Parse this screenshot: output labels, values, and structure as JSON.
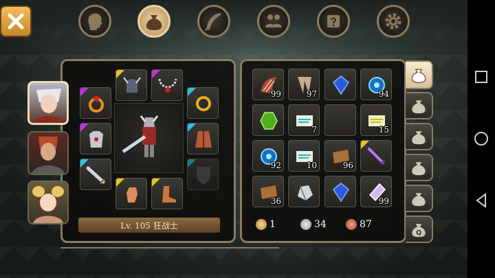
{
  "top_tabs": [
    {
      "name": "character-tab",
      "icon": "head-profile-icon",
      "active": false
    },
    {
      "name": "inventory-bag-tab",
      "icon": "bag-icon",
      "active": true
    },
    {
      "name": "skills-tab",
      "icon": "feather-icon",
      "active": false
    },
    {
      "name": "party-tab",
      "icon": "people-icon",
      "active": false
    },
    {
      "name": "quest-scroll-tab",
      "icon": "scroll-icon",
      "active": false
    },
    {
      "name": "settings-tab",
      "icon": "gear-icon",
      "active": false
    }
  ],
  "equipment": {
    "level_text": "Lv. 105 狂战士",
    "slots": [
      "helmet",
      "necklace",
      "ring-left",
      "ring-right",
      "armor",
      "cape",
      "weapon",
      "shield",
      "gloves",
      "boots"
    ]
  },
  "inventory": {
    "items": [
      {
        "icon": "claw-icon",
        "count": "99"
      },
      {
        "icon": "fang-icon",
        "count": "97"
      },
      {
        "icon": "blue-gem-icon",
        "count": ""
      },
      {
        "icon": "blue-orb-icon",
        "count": "94"
      },
      {
        "icon": "green-gem-icon",
        "count": ""
      },
      {
        "icon": "scroll-icon",
        "count": "7"
      },
      {
        "icon": "empty",
        "count": ""
      },
      {
        "icon": "yellow-scroll-icon",
        "count": "15"
      },
      {
        "icon": "blue-orb-icon",
        "count": "92"
      },
      {
        "icon": "scroll-icon",
        "count": "10"
      },
      {
        "icon": "leather-icon",
        "count": "96"
      },
      {
        "icon": "dagger-icon",
        "count": ""
      },
      {
        "icon": "leather-icon",
        "count": "36"
      },
      {
        "icon": "metal-ore-icon",
        "count": ""
      },
      {
        "icon": "blue-gem-icon",
        "count": ""
      },
      {
        "icon": "crystal-icon",
        "count": "99"
      }
    ],
    "currency": {
      "gold": "1",
      "silver": "34",
      "copper": "87"
    }
  },
  "bag_tabs": [
    {
      "label": "",
      "active": true
    },
    {
      "label": "",
      "active": false
    },
    {
      "label": "",
      "active": false
    },
    {
      "label": "",
      "active": false
    },
    {
      "label": "",
      "active": false
    },
    {
      "label": "Q",
      "active": false
    }
  ]
}
